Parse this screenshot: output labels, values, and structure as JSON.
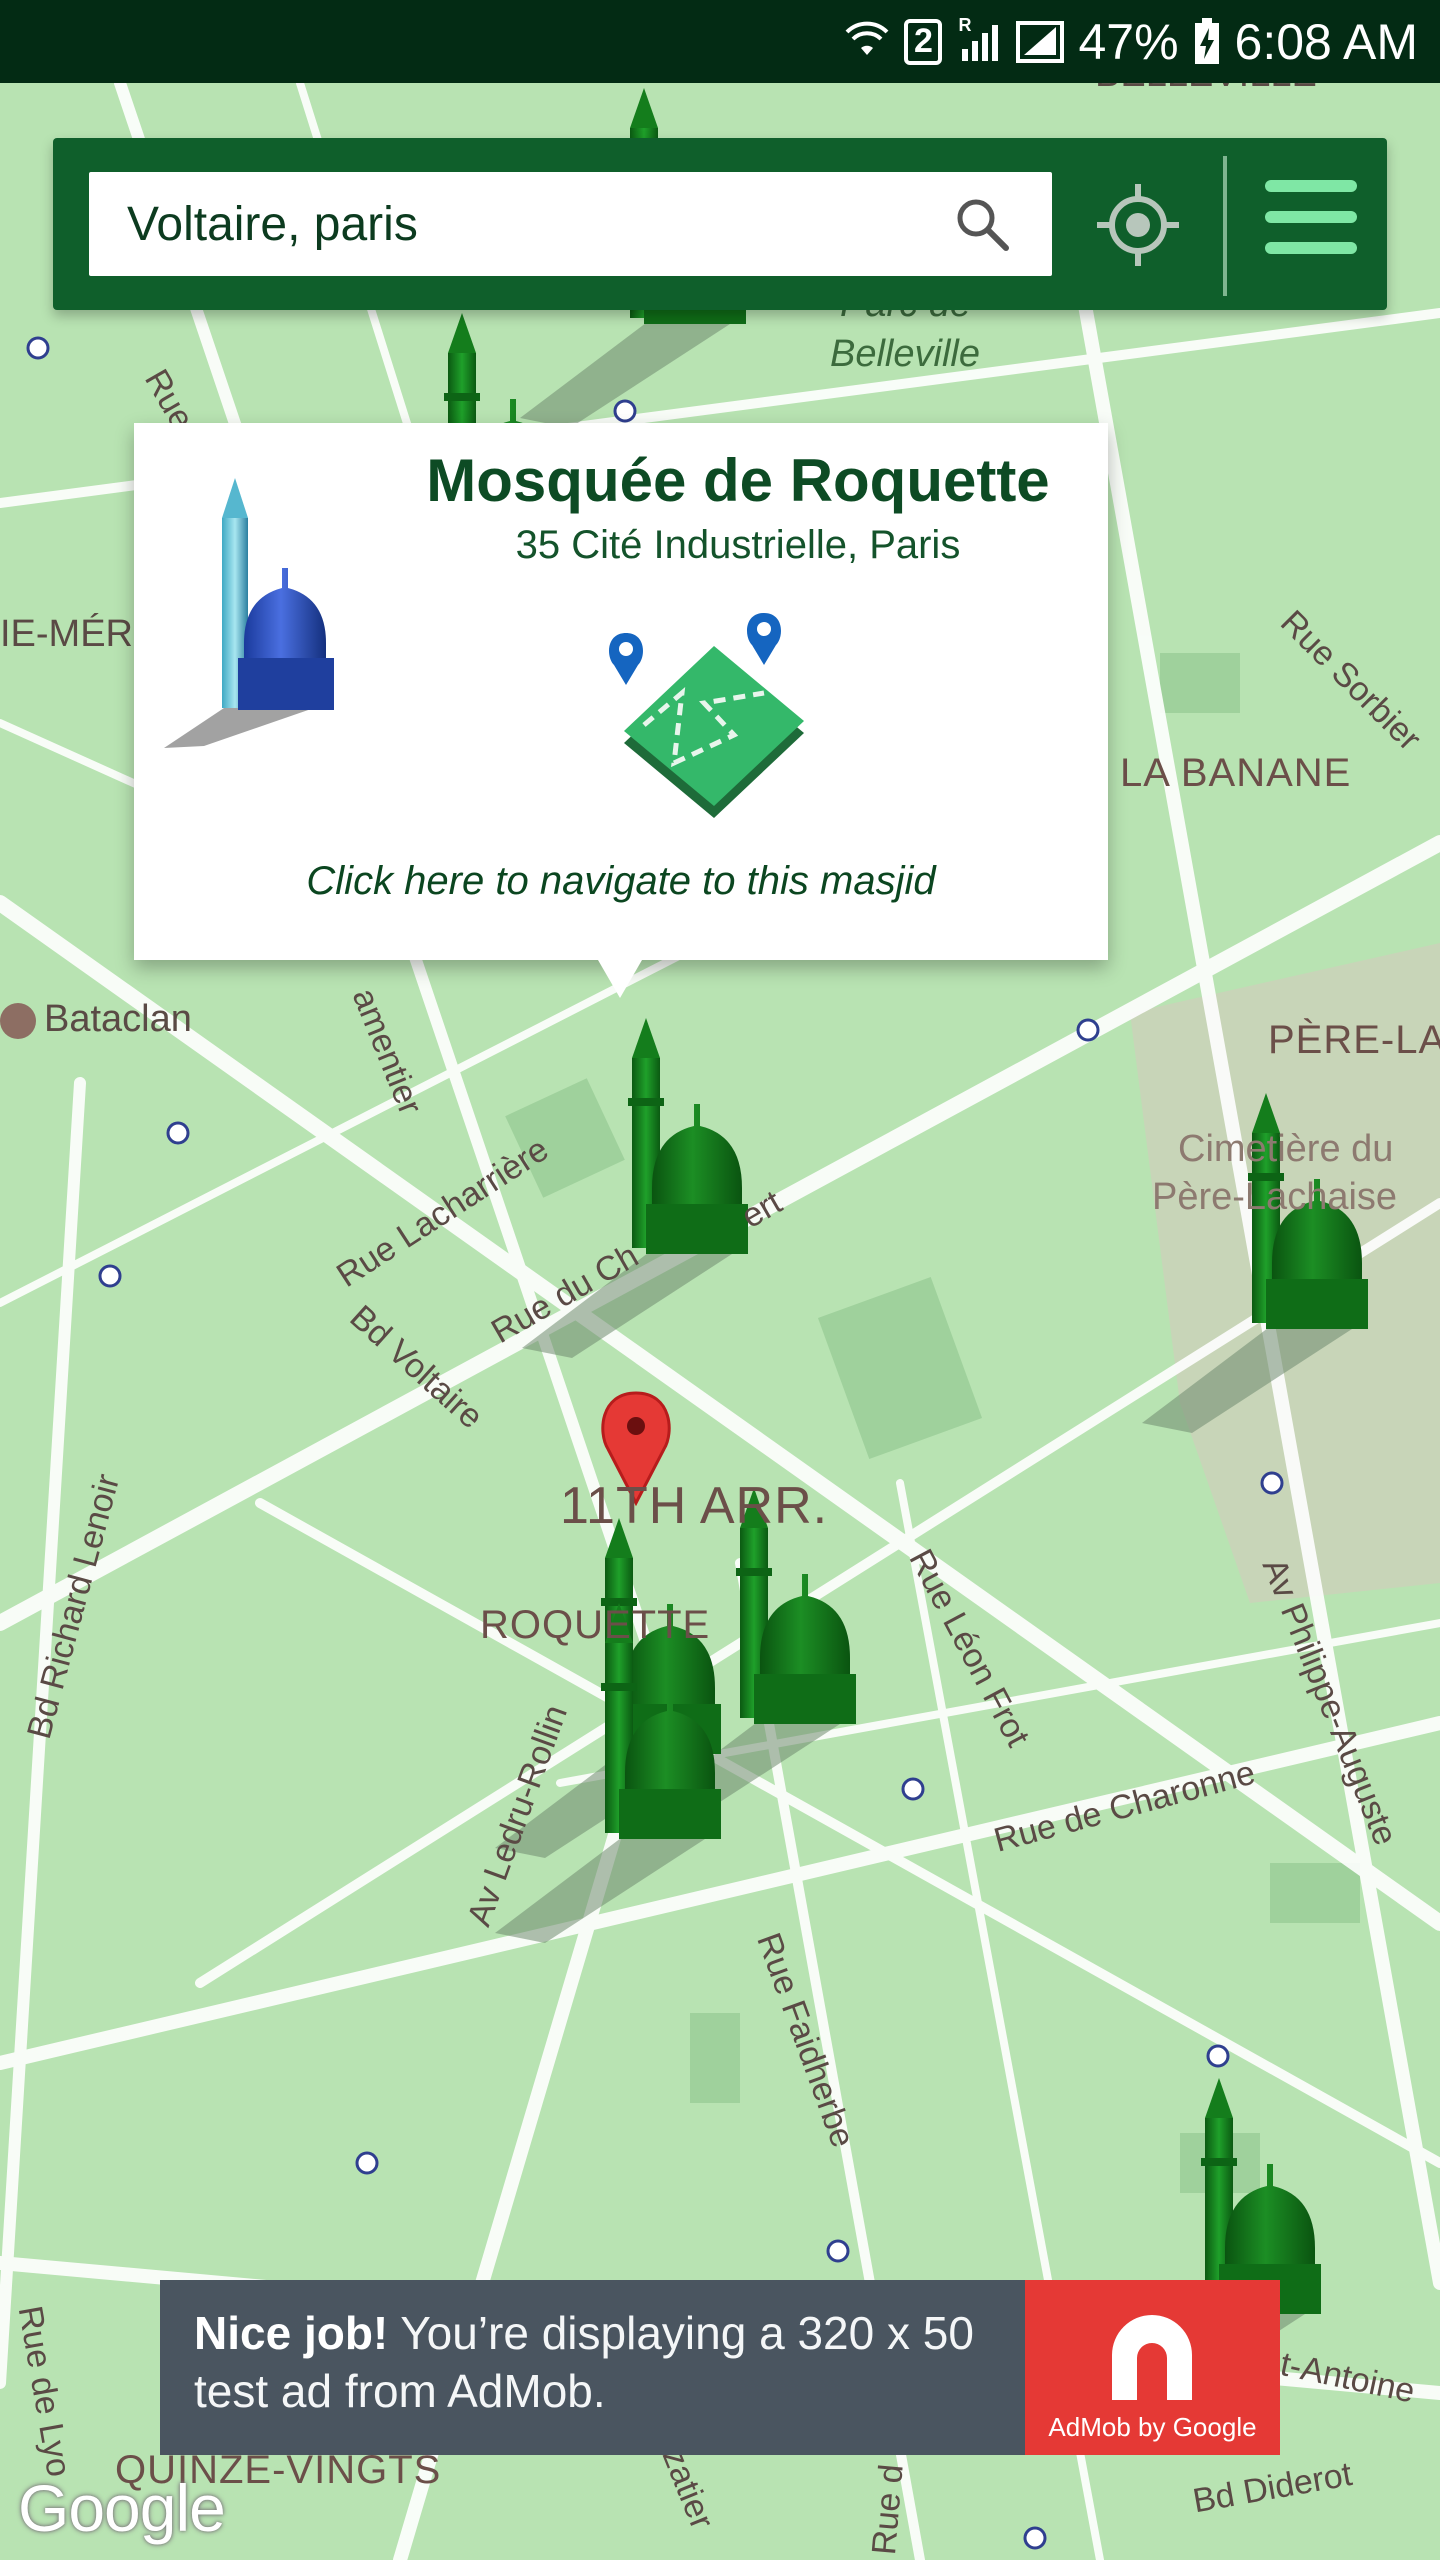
{
  "status_bar": {
    "sim_slot": "2",
    "signal_letter": "R",
    "battery": "47%",
    "time": "6:08 AM"
  },
  "search": {
    "value": "Voltaire, paris"
  },
  "info_window": {
    "name": "Mosquée de Roquette",
    "address": "35 Cité Industrielle, Paris",
    "cta": "Click here to navigate to this masjid"
  },
  "map": {
    "labels": {
      "belleville": "BELLEVILLE",
      "parc_1": "Parc de",
      "parc_2": "Belleville",
      "rue_saint": "Rue Saint",
      "ie_mer": "IE-MÉR",
      "la_banane": "LA BANANE",
      "rue_sorbier": "Rue Sorbier",
      "bataclan": "Bataclan",
      "amentier": "amentier",
      "pere_la": "PÈRE-LA",
      "rue_lacharriere": "Rue Lacharrière",
      "rue_du_ch": "Rue du Ch",
      "ert": "ert",
      "cimetiere_1": "Cimetière du",
      "cimetiere_2": "Père-Lachaise",
      "bd_voltaire": "Bd Voltaire",
      "onzieme": "11TH ARR.",
      "roquette": "ROQUETTE",
      "bd_richard_lenoir": "Bd Richard Lenoir",
      "rue_leon_frot": "Rue Léon Frot",
      "av_philippe_auguste": "Av Philippe-Auguste",
      "av_ledru_rollin": "Av Ledru-Rollin",
      "rue_de_charonne": "Rue de Charonne",
      "rue_faidherbe": "Rue Faidherbe",
      "rue_de_lyon": "Rue de Lyo",
      "quinze_vingts": "QUINZE-VINGTS",
      "antoine": "t-Antoine",
      "bd_diderot": "Bd Diderot",
      "zatier": "zatier",
      "rue_d": "Rue d"
    }
  },
  "ad": {
    "bold": "Nice job!",
    "text": " You’re displaying a 320 x 50 test ad from AdMob.",
    "brand": "AdMob by Google"
  },
  "google_logo": "Google",
  "colors": {
    "status_bar": "#032b14",
    "toolbar": "#0f5f2b",
    "map_bg": "#b8e3b2",
    "accent_green": "#7fe7a5",
    "ad_bg": "#4a5560",
    "ad_logo": "#e53935",
    "pin": "#e53935"
  }
}
